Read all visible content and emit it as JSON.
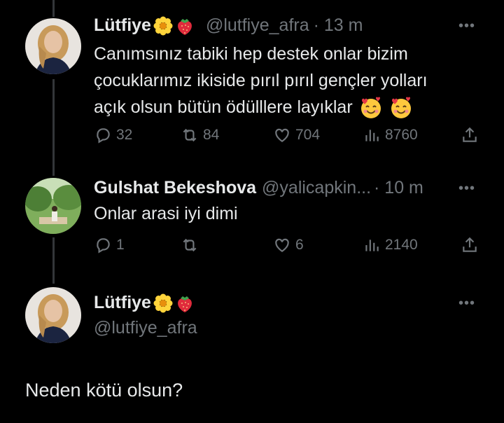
{
  "tweets": [
    {
      "name": "Lütfiye",
      "handle": "@lutfiye_afra",
      "time": "· 13 m",
      "text_lines": [
        "Canımsınız tabiki hep destek onlar bizim",
        "çocuklarımız ikiside pırıl pırıl gençler  yolları",
        "açık olsun bütün ödülllere layıklar"
      ],
      "replies": "32",
      "reposts": "84",
      "likes": "704",
      "views": "8760"
    },
    {
      "name": "Gulshat Bekeshova",
      "handle": "@yalicapkin...",
      "time": "· 10 m",
      "text": "Onlar arasi iyi dimi",
      "replies": "1",
      "reposts": "",
      "likes": "6",
      "views": "2140"
    },
    {
      "name": "Lütfiye",
      "handle": "@lutfiye_afra",
      "text": "Neden kötü olsun?"
    }
  ],
  "more_label": "•••",
  "icons": {
    "name_flair": [
      "blossom-icon",
      "strawberry-icon"
    ],
    "inline_emoji": "smiling-face-with-hearts-icon",
    "actions": [
      "reply-icon",
      "repost-icon",
      "like-icon",
      "views-icon",
      "share-icon"
    ]
  },
  "colors": {
    "background": "#000000",
    "text": "#e7e9ea",
    "muted": "#71767b",
    "thread_line": "#333639"
  }
}
